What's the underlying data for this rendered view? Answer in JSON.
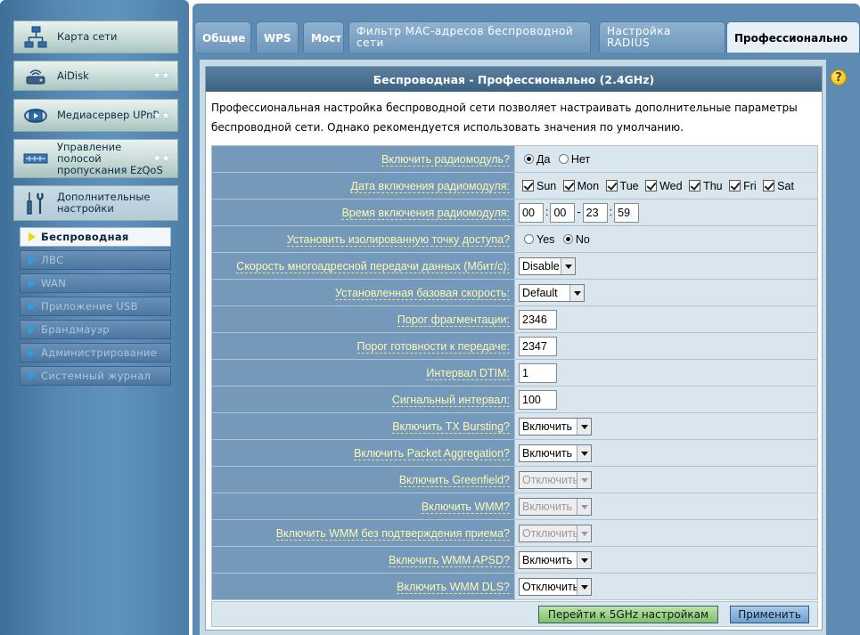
{
  "sidebar": {
    "menu": [
      {
        "label": "Карта сети",
        "icon": "network-map-icon"
      },
      {
        "label": "AiDisk",
        "icon": "aidisk-icon",
        "stars": "★★"
      },
      {
        "label": "Медиасервер UPnP",
        "icon": "upnp-media-icon",
        "stars": "★★"
      },
      {
        "label": "Управление полосой пропускания EzQoS",
        "icon": "ezqos-icon",
        "stars": "★★"
      },
      {
        "label": "Дополнительные настройки",
        "icon": "wrench-icon"
      }
    ],
    "submenu": [
      {
        "label": "Беспроводная",
        "selected": true
      },
      {
        "label": "ЛВС"
      },
      {
        "label": "WAN"
      },
      {
        "label": "Приложение USB"
      },
      {
        "label": "Брандмауэр"
      },
      {
        "label": "Администрирование"
      },
      {
        "label": "Системный журнал"
      }
    ]
  },
  "tabs": [
    {
      "label": "Общие"
    },
    {
      "label": "WPS"
    },
    {
      "label": "Мост"
    },
    {
      "label": "Фильтр MAC-адресов беспроводной сети"
    },
    {
      "label": "Настройка RADIUS"
    },
    {
      "label": "Профессионально",
      "active": true
    }
  ],
  "help_icon": "?",
  "section": {
    "title": "Беспроводная - Профессионально (2.4GHz)",
    "description": "Профессиональная настройка беспроводной сети позволяет настраивать дополнительные параметры беспроводной сети. Однако рекомендуется использовать значения по умолчанию."
  },
  "settings": {
    "radio_enable": {
      "label": "Включить радиомодуль?",
      "opt_yes": "Да",
      "opt_no": "Нет",
      "selected": "Да"
    },
    "radio_date": {
      "label": "Дата включения радиомодуля:",
      "days": [
        "Sun",
        "Mon",
        "Tue",
        "Wed",
        "Thu",
        "Fri",
        "Sat"
      ]
    },
    "radio_time": {
      "label": "Время включения радиомодуля:",
      "start_h": "00",
      "start_m": "00",
      "end_h": "23",
      "end_m": "59",
      "sep_colon": ":",
      "sep_dash": "-"
    },
    "ap_isolate": {
      "label": "Установить изолированную точку доступа?",
      "opt_yes": "Yes",
      "opt_no": "No",
      "selected": "No"
    },
    "multicast_rate": {
      "label": "Скорость многоадресной передачи данных (Мбит/с):",
      "value": "Disable"
    },
    "basic_rate": {
      "label": "Установленная базовая скорость:",
      "value": "Default"
    },
    "frag_threshold": {
      "label": "Порог фрагментации:",
      "value": "2346"
    },
    "rts_threshold": {
      "label": "Порог готовности к передаче:",
      "value": "2347"
    },
    "dtim": {
      "label": "Интервал DTIM:",
      "value": "1"
    },
    "beacon": {
      "label": "Сигнальный интервал:",
      "value": "100"
    },
    "tx_bursting": {
      "label": "Включить TX Bursting?",
      "value": "Включить"
    },
    "packet_aggregation": {
      "label": "Включить Packet Aggregation?",
      "value": "Включить"
    },
    "greenfield": {
      "label": "Включить Greenfield?",
      "value": "Отключить",
      "disabled": true
    },
    "wmm": {
      "label": "Включить WMM?",
      "value": "Включить",
      "disabled": true
    },
    "wmm_noack": {
      "label": "Включить WMM без подтверждения приема?",
      "value": "Отключить",
      "disabled": true
    },
    "wmm_apsd": {
      "label": "Включить WMM APSD?",
      "value": "Включить"
    },
    "wmm_dls": {
      "label": "Включить WMM DLS?",
      "value": "Отключить"
    }
  },
  "buttons": {
    "goto_5ghz": "Перейти к 5GHz настройкам",
    "apply": "Применить"
  }
}
